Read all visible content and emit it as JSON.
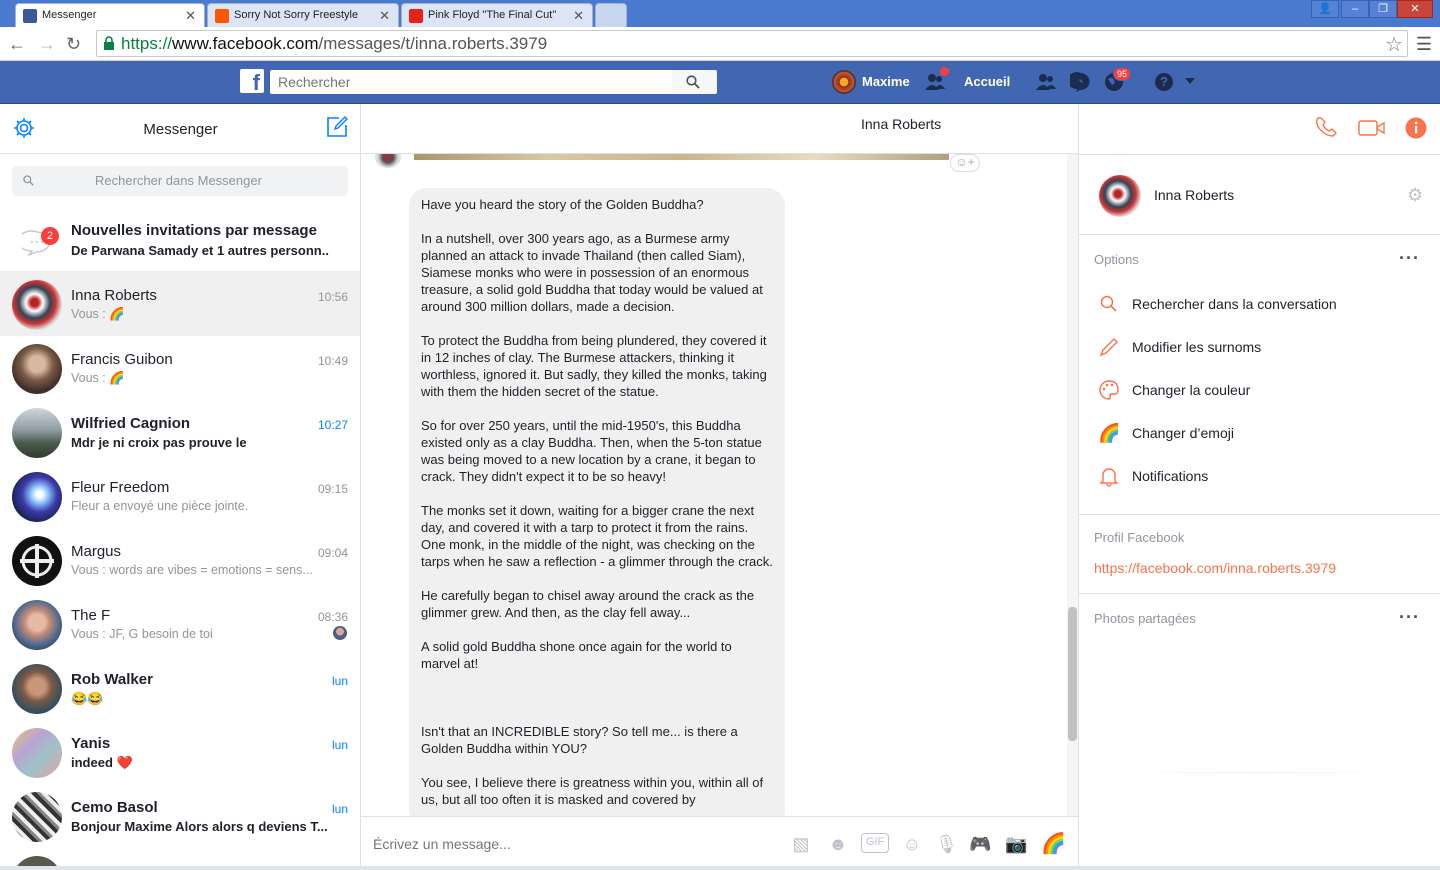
{
  "browser": {
    "tabs": [
      {
        "title": "Messenger",
        "active": true
      },
      {
        "title": "Sorry Not Sorry Freestyle",
        "active": false
      },
      {
        "title": "Pink Floyd \"The Final Cut\"",
        "active": false
      }
    ],
    "url_scheme": "https://",
    "url_host": "www.facebook.com",
    "url_path": "/messages/t/inna.roberts.3979"
  },
  "fb_bar": {
    "search_placeholder": "Rechercher",
    "user_name": "Maxime",
    "home_label": "Accueil",
    "notification_count": "95"
  },
  "left": {
    "title": "Messenger",
    "search_placeholder": "Rechercher dans Messenger",
    "invites": {
      "count": "2",
      "title": "Nouvelles invitations par message",
      "subtitle": "De Parwana Samady et 1 autres personn.."
    },
    "conversations": [
      {
        "name": "Inna Roberts",
        "snippet": "Vous : 🌈",
        "time": "10:56",
        "selected": true,
        "unread": false
      },
      {
        "name": "Francis Guibon",
        "snippet": "Vous : 🌈",
        "time": "10:49",
        "selected": false,
        "unread": false
      },
      {
        "name": "Wilfried Cagnion",
        "snippet": "Mdr je ni croix pas prouve le",
        "time": "10:27",
        "selected": false,
        "unread": true
      },
      {
        "name": "Fleur Freedom",
        "snippet": "Fleur a envoyé une pièce jointe.",
        "time": "09:15",
        "selected": false,
        "unread": false
      },
      {
        "name": "Margus",
        "snippet": "Vous : words are vibes = emotions = sens...",
        "time": "09:04",
        "selected": false,
        "unread": false
      },
      {
        "name": "The F",
        "snippet": "Vous : JF, G besoin de toi",
        "time": "08:36",
        "selected": false,
        "unread": false
      },
      {
        "name": "Rob Walker",
        "snippet": "😂😂",
        "time": "lun",
        "selected": false,
        "unread": true
      },
      {
        "name": "Yanis",
        "snippet": "indeed ❤️",
        "time": "lun",
        "selected": false,
        "unread": true
      },
      {
        "name": "Cemo Basol",
        "snippet": "Bonjour Maxime Alors alors q deviens T...",
        "time": "lun",
        "selected": false,
        "unread": true
      }
    ]
  },
  "thread": {
    "title": "Inna Roberts",
    "message_paragraphs": [
      "Have you heard the story of the Golden Buddha?",
      "In a nutshell, over 300 years ago, as a Burmese army planned an attack to invade Thailand (then called Siam), Siamese monks who were in possession of an enormous treasure, a solid gold Buddha that today would be valued at around 300 million dollars, made a decision.",
      "To protect the Buddha from being plundered, they covered it in 12 inches of clay. The Burmese attackers, thinking it worthless, ignored it. But sadly, they killed the monks, taking with them the hidden secret of the statue.",
      "So for over 250 years, until the mid-1950's, this Buddha existed only as a clay Buddha. Then, when the 5-ton statue was being moved to a new location by a crane, it began to crack. They didn't expect it to be so heavy!",
      "The monks set it down, waiting for a bigger crane the next day, and covered it with a tarp to protect it from the rains. One monk, in the middle of the night, was checking on the tarps when he saw a reflection - a glimmer through the crack.",
      "He carefully began to chisel away around the crack as the glimmer grew. And then, as the clay fell away...",
      "A solid gold Buddha shone once again for the world to marvel at!",
      "Isn't that an INCREDIBLE story? So tell me... is there a Golden Buddha within YOU?",
      "You see, I believe there is greatness within you, within all of us, but all too often it is masked and covered by"
    ],
    "composer_placeholder": "Écrivez un message..."
  },
  "right": {
    "profile_name": "Inna Roberts",
    "options_title": "Options",
    "options": [
      {
        "label": "Rechercher dans la conversation",
        "icon": "search-icon"
      },
      {
        "label": "Modifier les surnoms",
        "icon": "pencil-icon"
      },
      {
        "label": "Changer la couleur",
        "icon": "palette-icon"
      },
      {
        "label": "Changer d’emoji",
        "icon": "rainbow-icon"
      },
      {
        "label": "Notifications",
        "icon": "bell-icon"
      }
    ],
    "profile_section_title": "Profil Facebook",
    "profile_link": "https://facebook.com/inna.roberts.3979",
    "photos_title": "Photos partagées"
  },
  "colors": {
    "fb_blue": "#4267b2",
    "accent_orange": "#f7734a",
    "messenger_blue": "#0084ff",
    "badge_red": "#fa3e3e"
  }
}
